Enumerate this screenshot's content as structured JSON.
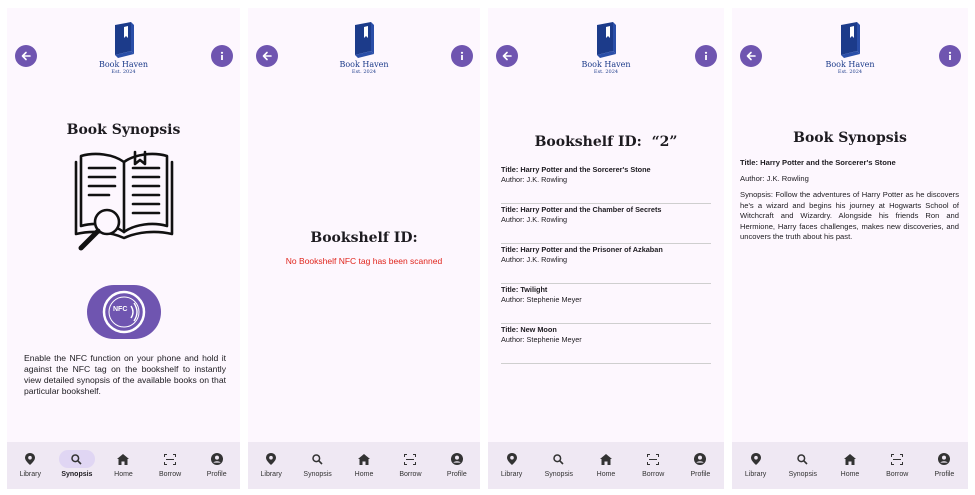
{
  "app": {
    "brand": "Book Haven",
    "established": "Est. 2024",
    "accent_color": "#6f55b0",
    "logo_color": "#1c3b8a"
  },
  "nav": {
    "library": "Library",
    "synopsis": "Synopsis",
    "home": "Home",
    "borrow": "Borrow",
    "profile": "Profile"
  },
  "screen1": {
    "title": "Book Synopsis",
    "nfc_label": "NFC",
    "description": "Enable the NFC function on your phone and hold it against the NFC tag on the bookshelf to instantly view detailed synopsis of the available books on that particular bookshelf."
  },
  "screen2": {
    "title": "Bookshelf ID:",
    "error": "No Bookshelf NFC tag has been scanned"
  },
  "screen3": {
    "title": "Bookshelf ID:  “2”",
    "books": [
      {
        "title": "Title: Harry Potter and the Sorcerer's Stone",
        "author": "Author: J.K. Rowling"
      },
      {
        "title": "Title: Harry Potter and the Chamber of Secrets",
        "author": "Author: J.K. Rowling"
      },
      {
        "title": "Title: Harry Potter and the Prisoner of Azkaban",
        "author": "Author: J.K. Rowling"
      },
      {
        "title": "Title: Twilight",
        "author": "Author: Stephenie Meyer"
      },
      {
        "title": "Title: New Moon",
        "author": "Author: Stephenie Meyer"
      }
    ]
  },
  "screen4": {
    "title": "Book Synopsis",
    "book_title": "Title: Harry Potter and the Sorcerer's Stone",
    "author": "Author: J.K. Rowling",
    "synopsis": "Synopsis: Follow the adventures of Harry Potter as he discovers he's a wizard and begins his journey at Hogwarts School of Witchcraft and Wizardry. Alongside his friends Ron and Hermione, Harry faces challenges, makes new discoveries, and uncovers the truth about his past."
  }
}
